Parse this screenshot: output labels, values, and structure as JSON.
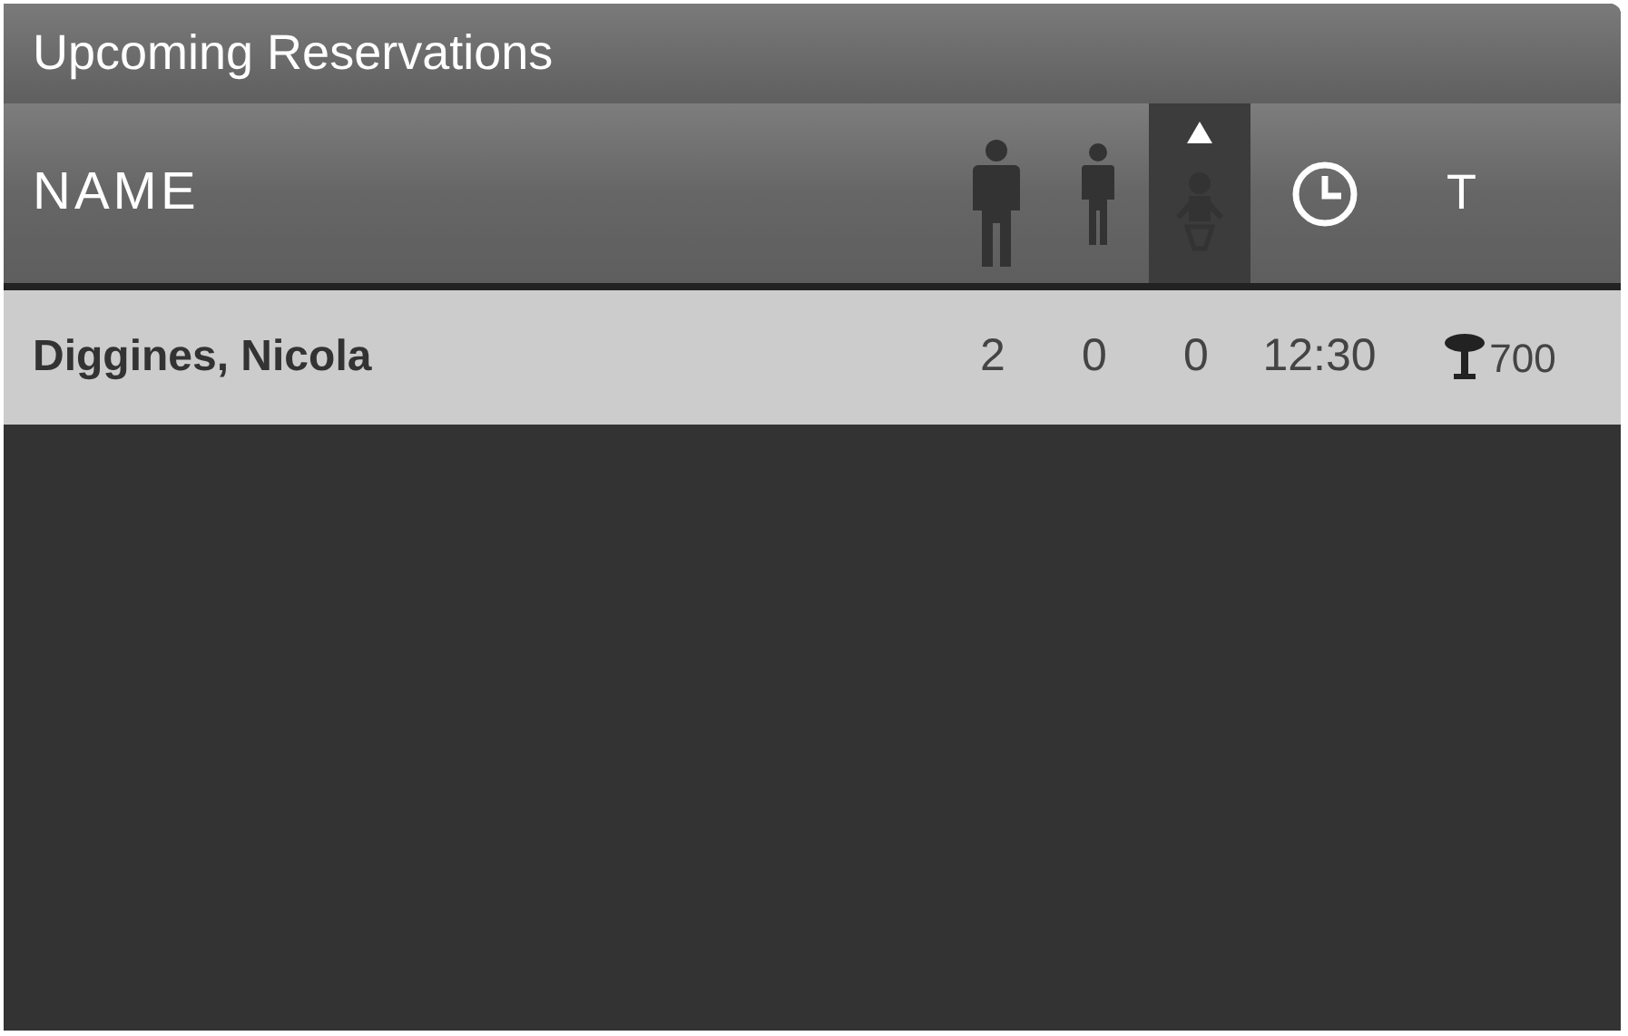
{
  "panel": {
    "title": "Upcoming Reservations"
  },
  "columns": [
    {
      "kind": "name",
      "label": "NAME",
      "selected": false
    },
    {
      "kind": "adults",
      "selected": false
    },
    {
      "kind": "children",
      "selected": false
    },
    {
      "kind": "infants",
      "selected": true
    },
    {
      "kind": "time",
      "selected": false
    },
    {
      "kind": "table",
      "label": "T",
      "selected": false
    }
  ],
  "rows": [
    {
      "name": "Diggines, Nicola",
      "adults": "2",
      "children": "0",
      "infants": "0",
      "time": "12:30",
      "table": "700"
    }
  ]
}
